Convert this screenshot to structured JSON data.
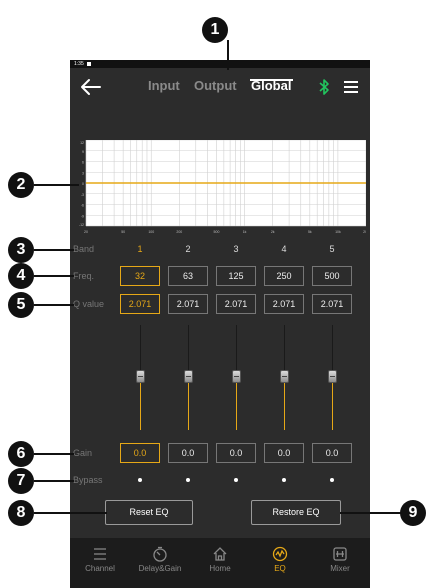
{
  "status_bar": {
    "time": "1:35"
  },
  "header": {
    "tabs": [
      {
        "label": "Input"
      },
      {
        "label": "Output"
      },
      {
        "label": "Global"
      }
    ],
    "active_tab": "Global"
  },
  "graph": {
    "y_ticks": [
      "12",
      "9",
      "6",
      "3",
      "0",
      "-3",
      "-6",
      "-9",
      "-12"
    ],
    "x_ticks": [
      "20",
      "50",
      "100",
      "200",
      "500",
      "1k",
      "2k",
      "5k",
      "10k",
      "20k"
    ]
  },
  "rows": {
    "band_label": "Band",
    "freq_label": "Freq.",
    "q_label": "Q value",
    "gain_label": "Gain",
    "bypass_label": "Bypass"
  },
  "bands": [
    {
      "num": "1",
      "freq": "32",
      "q": "2.071",
      "gain": "0.0"
    },
    {
      "num": "2",
      "freq": "63",
      "q": "2.071",
      "gain": "0.0"
    },
    {
      "num": "3",
      "freq": "125",
      "q": "2.071",
      "gain": "0.0"
    },
    {
      "num": "4",
      "freq": "250",
      "q": "2.071",
      "gain": "0.0"
    },
    {
      "num": "5",
      "freq": "500",
      "q": "2.071",
      "gain": "0.0"
    }
  ],
  "buttons": {
    "reset": "Reset EQ",
    "restore": "Restore EQ"
  },
  "nav": [
    {
      "label": "Channel",
      "icon": "list-icon"
    },
    {
      "label": "Delay&Gain",
      "icon": "timer-icon"
    },
    {
      "label": "Home",
      "icon": "home-icon"
    },
    {
      "label": "EQ",
      "icon": "eq-icon"
    },
    {
      "label": "Mixer",
      "icon": "mixer-icon"
    }
  ],
  "callouts": [
    "1",
    "2",
    "3",
    "4",
    "5",
    "6",
    "7",
    "8",
    "9"
  ],
  "colors": {
    "accent": "#e6a817",
    "background": "#2c2c2c",
    "bluetooth": "#22c55e"
  }
}
